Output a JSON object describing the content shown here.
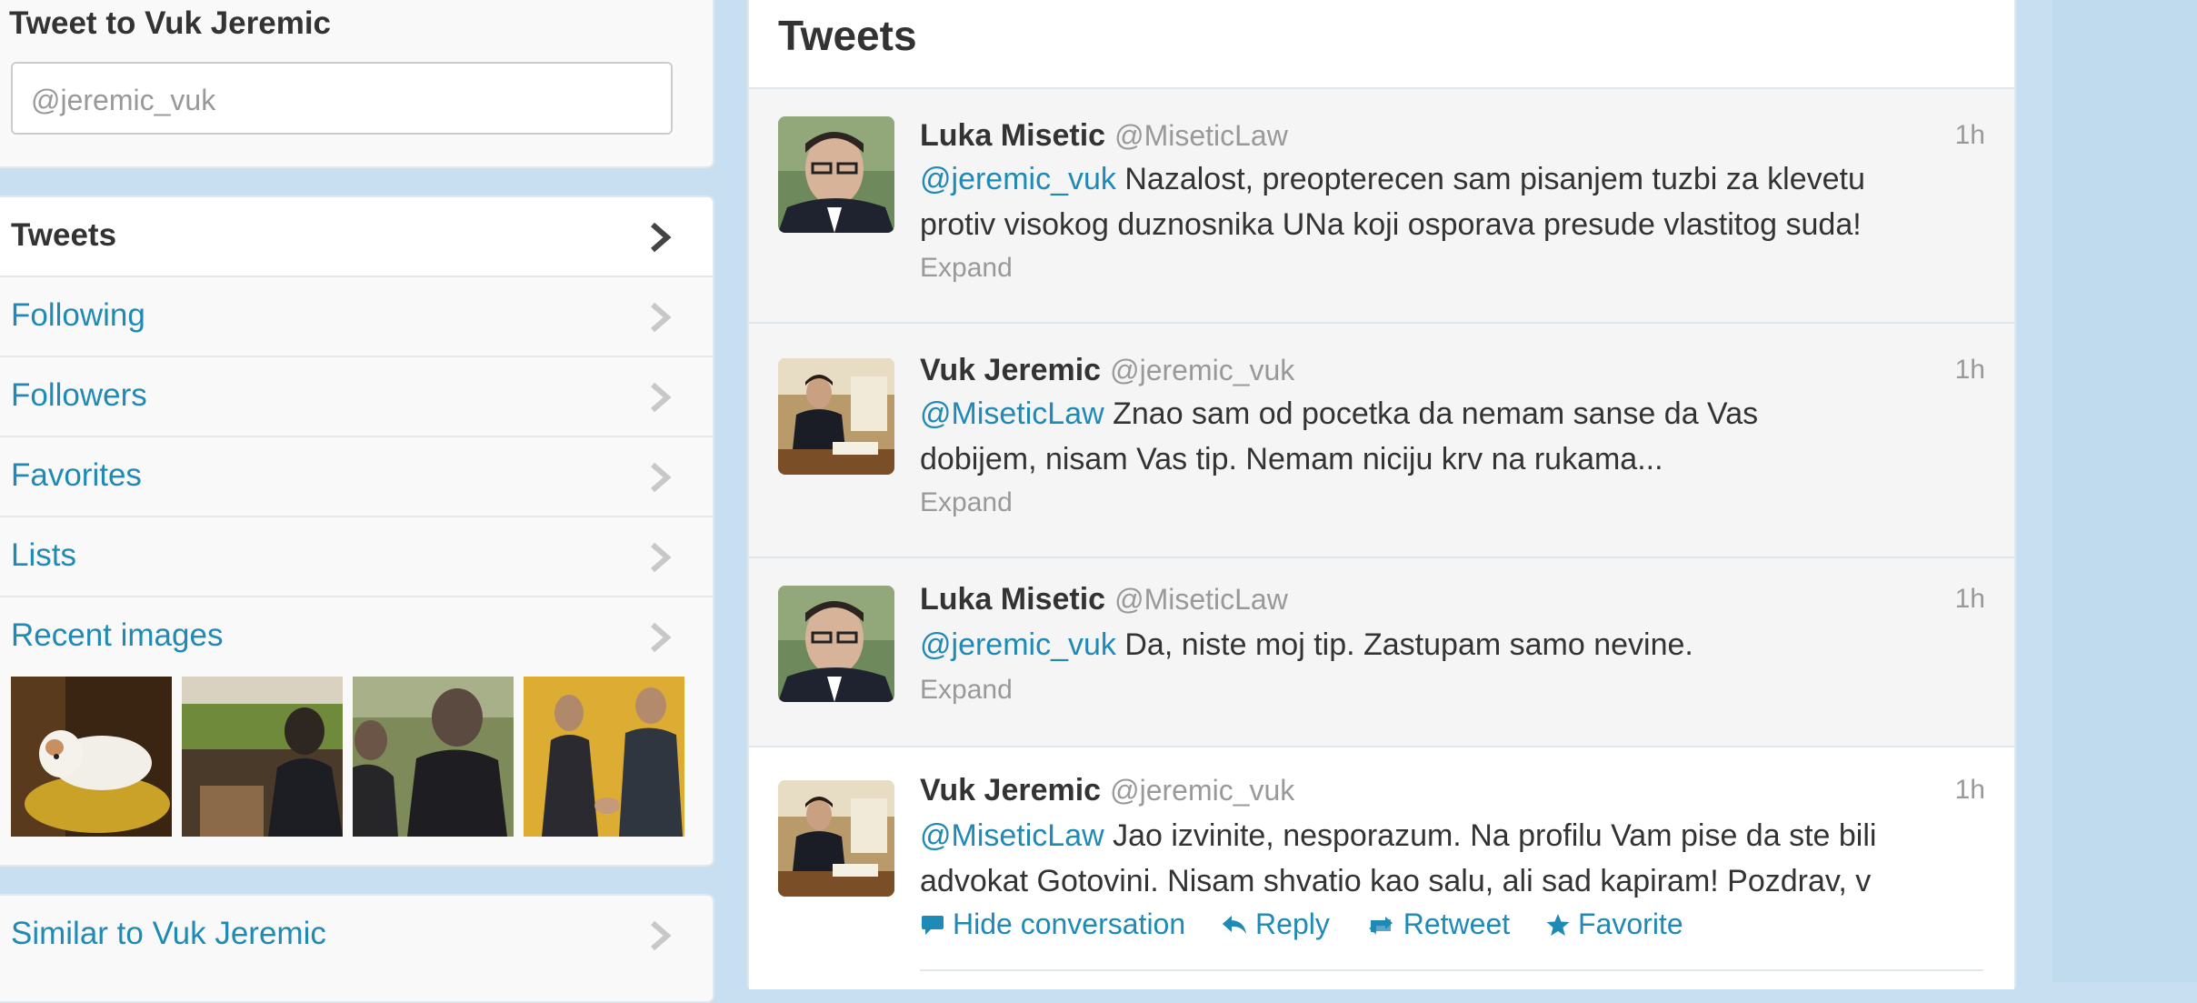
{
  "compose": {
    "title": "Tweet to Vuk Jeremic",
    "placeholder": "@jeremic_vuk"
  },
  "nav": {
    "items": [
      {
        "label": "Tweets"
      },
      {
        "label": "Following"
      },
      {
        "label": "Followers"
      },
      {
        "label": "Favorites"
      },
      {
        "label": "Lists"
      },
      {
        "label": "Recent images"
      }
    ],
    "similar_label": "Similar to Vuk Jeremic"
  },
  "timeline": {
    "title": "Tweets",
    "tweets": [
      {
        "name": "Luka Misetic",
        "handle": "@MiseticLaw",
        "time": "1h",
        "mention": "@jeremic_vuk",
        "line1": " Nazalost, preopterecen sam pisanjem tuzbi za klevetu",
        "line2": "protiv visokog duznosnika UNa koji osporava presude vlastitog suda!",
        "expand": "Expand"
      },
      {
        "name": "Vuk Jeremic",
        "handle": "@jeremic_vuk",
        "time": "1h",
        "mention": "@MiseticLaw",
        "line1": " Znao sam od pocetka da nemam sanse da Vas",
        "line2": "dobijem, nisam Vas tip. Nemam niciju krv na rukama...",
        "expand": "Expand"
      },
      {
        "name": "Luka Misetic",
        "handle": "@MiseticLaw",
        "time": "1h",
        "mention": "@jeremic_vuk",
        "line1": " Da, niste moj tip. Zastupam samo nevine.",
        "expand": "Expand"
      },
      {
        "name": "Vuk Jeremic",
        "handle": "@jeremic_vuk",
        "time": "1h",
        "mention": "@MiseticLaw",
        "line1": " Jao izvinite, nesporazum. Na profilu Vam pise da ste bili",
        "line2": "advokat Gotovini. Nisam shvatio kao salu, ali sad kapiram! Pozdrav, v",
        "actions": {
          "hide": "Hide conversation",
          "reply": "Reply",
          "retweet": "Retweet",
          "favorite": "Favorite"
        }
      }
    ]
  },
  "colors": {
    "link": "#1f8ab5",
    "page_bg": "#c7dff0",
    "muted": "#999999"
  }
}
